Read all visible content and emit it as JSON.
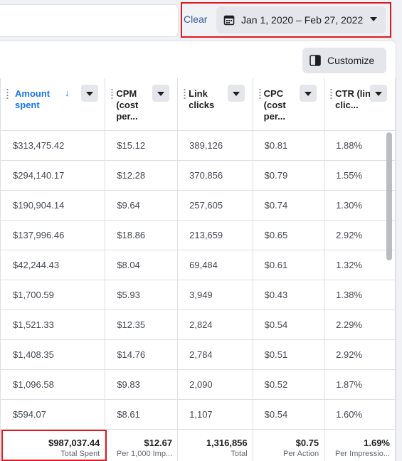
{
  "toolbar": {
    "clear_label": "Clear",
    "date_range": "Jan 1, 2020 – Feb 27, 2022",
    "customize_label": "Customize"
  },
  "columns": [
    {
      "label": "Amount spent",
      "sorted": true,
      "sort_direction": "descending"
    },
    {
      "label": "CPM (cost per..."
    },
    {
      "label": "Link clicks"
    },
    {
      "label": "CPC (cost per..."
    },
    {
      "label": "CTR (link clic..."
    }
  ],
  "rows": [
    [
      "$313,475.42",
      "$15.12",
      "389,126",
      "$0.81",
      "1.88%"
    ],
    [
      "$294,140.17",
      "$12.28",
      "370,856",
      "$0.79",
      "1.55%"
    ],
    [
      "$190,904.14",
      "$9.64",
      "257,605",
      "$0.74",
      "1.30%"
    ],
    [
      "$137,996.46",
      "$18.86",
      "213,659",
      "$0.65",
      "2.92%"
    ],
    [
      "$42,244.43",
      "$8.04",
      "69,484",
      "$0.61",
      "1.32%"
    ],
    [
      "$1,700.59",
      "$5.93",
      "3,949",
      "$0.43",
      "1.38%"
    ],
    [
      "$1,521.33",
      "$12.35",
      "2,824",
      "$0.54",
      "2.29%"
    ],
    [
      "$1,408.35",
      "$14.76",
      "2,784",
      "$0.51",
      "2.92%"
    ],
    [
      "$1,096.58",
      "$9.83",
      "2,090",
      "$0.52",
      "1.87%"
    ],
    [
      "$594.07",
      "$8.61",
      "1,107",
      "$0.54",
      "1.60%"
    ]
  ],
  "totals": [
    {
      "value": "$987,037.44",
      "label": "Total Spent"
    },
    {
      "value": "$12.67",
      "label": "Per 1,000 Imp..."
    },
    {
      "value": "1,316,856",
      "label": "Total"
    },
    {
      "value": "$0.75",
      "label": "Per Action"
    },
    {
      "value": "1.69%",
      "label": "Per Impressio..."
    }
  ],
  "colors": {
    "accent": "#1877f2",
    "link": "#385898",
    "highlight": "#e0191f"
  },
  "icons": {
    "date": "calendar-icon",
    "customize": "columns-panel-icon",
    "sort": "arrow-down-icon"
  }
}
